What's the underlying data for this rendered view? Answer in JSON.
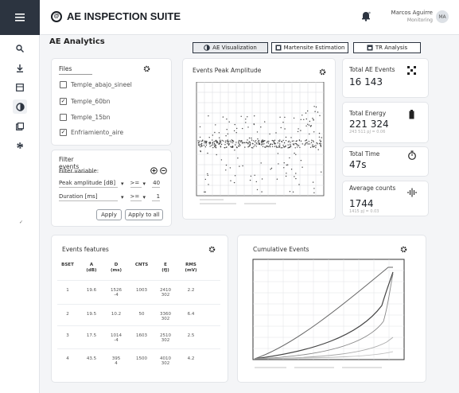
{
  "app": {
    "title": "AE INSPECTION SUITE",
    "logo": "@"
  },
  "user": {
    "name": "Marcos Aguirre",
    "role": "Monitoring",
    "initials": "MA"
  },
  "section_title": "AE Analytics",
  "tabs": [
    {
      "label": "AE Visualization",
      "active": true
    },
    {
      "label": "Martensite Estimation",
      "active": false
    },
    {
      "label": "TR Analysis",
      "active": false
    }
  ],
  "files": {
    "title": "Files",
    "items": [
      {
        "label": "Temple_abajo_sineel",
        "checked": false
      },
      {
        "label": "Temple_60bn",
        "checked": true
      },
      {
        "label": "Temple_15bn",
        "checked": false
      },
      {
        "label": "Enfriamiento_aire",
        "checked": true
      }
    ]
  },
  "filter": {
    "title": "Filter events",
    "variable_label": "Filter variable:",
    "rows": [
      {
        "name": "Peak amplitude [dB]",
        "op": ">=",
        "value": "40"
      },
      {
        "name": "Duration [ms]",
        "op": ">=",
        "value": "1"
      }
    ],
    "apply_label": "Apply",
    "apply_all_label": "Apply to all"
  },
  "peak_chart": {
    "title": "Events Peak Amplitude"
  },
  "kpis": [
    {
      "label": "Total AE Events",
      "value": "16 143",
      "sub": "",
      "icon": "dice-icon"
    },
    {
      "label": "Total Energy",
      "value": "221 324",
      "sub": "243 511 pJ = 0.06",
      "icon": "battery-icon"
    },
    {
      "label": "Total Time",
      "value": "47s",
      "sub": "",
      "icon": "stopwatch-icon"
    },
    {
      "label": "Average counts",
      "value": "1744",
      "sub": "1415 pJ = 0.03",
      "icon": "waveform-icon"
    }
  ],
  "features": {
    "title": "Events features",
    "headers": [
      "BSET",
      "A\n(dB)",
      "D\n(ms)",
      "CNTS",
      "E\n(fJ)",
      "RMS\n(mV)"
    ],
    "rows": [
      [
        "1",
        "19.6",
        "1526\n-4",
        "1003",
        "2410\n302",
        "2.2"
      ],
      [
        "2",
        "19.5",
        "10.2",
        "50",
        "3360\n302",
        "6.4"
      ],
      [
        "3",
        "17.5",
        "1014\n-4",
        "1603",
        "2510\n302",
        "2.5"
      ],
      [
        "4",
        "43.5",
        "395\n4",
        "1500",
        "4010\n302",
        "4.2"
      ]
    ]
  },
  "cumulative": {
    "title": "Cumulative Events"
  },
  "colors": {
    "rail": "#2c3440",
    "accent": "#1b1f25"
  }
}
